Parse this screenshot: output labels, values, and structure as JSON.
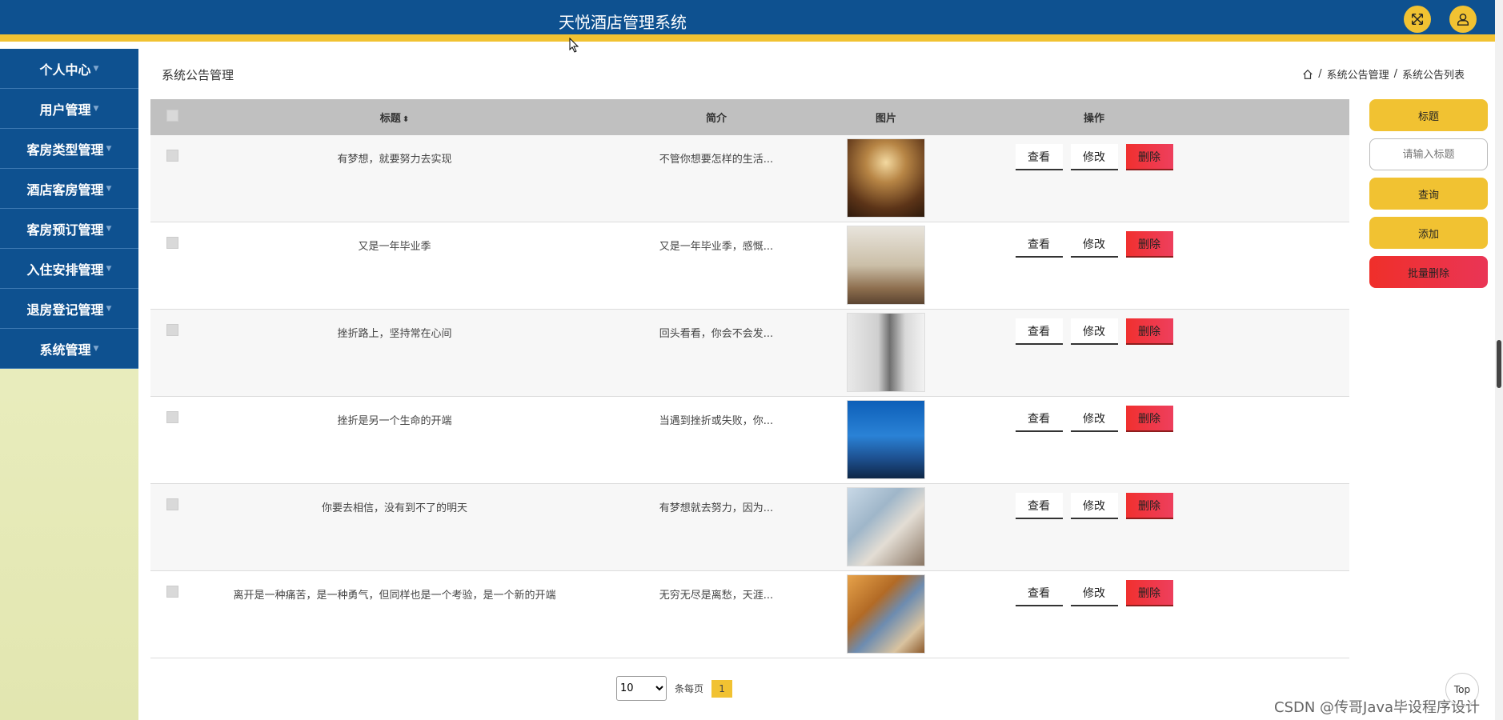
{
  "header": {
    "title": "天悦酒店管理系统",
    "fullscreen_icon": "fullscreen-icon",
    "user_icon": "user-icon"
  },
  "sidebar": {
    "items": [
      {
        "label": "个人中心"
      },
      {
        "label": "用户管理"
      },
      {
        "label": "客房类型管理"
      },
      {
        "label": "酒店客房管理"
      },
      {
        "label": "客房预订管理"
      },
      {
        "label": "入住安排管理"
      },
      {
        "label": "退房登记管理"
      },
      {
        "label": "系统管理"
      }
    ]
  },
  "page": {
    "heading": "系统公告管理",
    "breadcrumb": [
      "系统公告管理",
      "系统公告列表"
    ]
  },
  "table": {
    "columns": {
      "title": "标题",
      "desc": "简介",
      "image": "图片",
      "ops": "操作"
    },
    "ops": {
      "view": "查看",
      "edit": "修改",
      "delete": "删除"
    },
    "rows": [
      {
        "title": "有梦想，就要努力去实现",
        "desc": "不管你想要怎样的生活...",
        "image": "ballroom"
      },
      {
        "title": "又是一年毕业季",
        "desc": "又是一年毕业季，感慨...",
        "image": "hotel-room"
      },
      {
        "title": "挫折路上，坚持常在心间",
        "desc": "回头看看，你会不会发...",
        "image": "grey-room"
      },
      {
        "title": "挫折是另一个生命的开端",
        "desc": "当遇到挫折或失败，你...",
        "image": "hotel-tower"
      },
      {
        "title": "你要去相信，没有到不了的明天",
        "desc": "有梦想就去努力，因为...",
        "image": "bright-room"
      },
      {
        "title": "离开是一种痛苦，是一种勇气，但同样也是一个考验，是一个新的开端",
        "desc": "无穷无尽是离愁，天涯...",
        "image": "suite"
      }
    ]
  },
  "rpanel": {
    "title_btn": "标题",
    "search_placeholder": "请输入标题",
    "query_btn": "查询",
    "add_btn": "添加",
    "batch_delete_btn": "批量删除"
  },
  "pager": {
    "page_size": "10",
    "per_page_label": "条每页",
    "current_page": "1"
  },
  "top_button": "Top",
  "watermark": "CSDN @传哥Java毕设程序设计",
  "colors": {
    "primary": "#0e5190",
    "accent": "#f1c232",
    "danger": "#f0302f"
  }
}
